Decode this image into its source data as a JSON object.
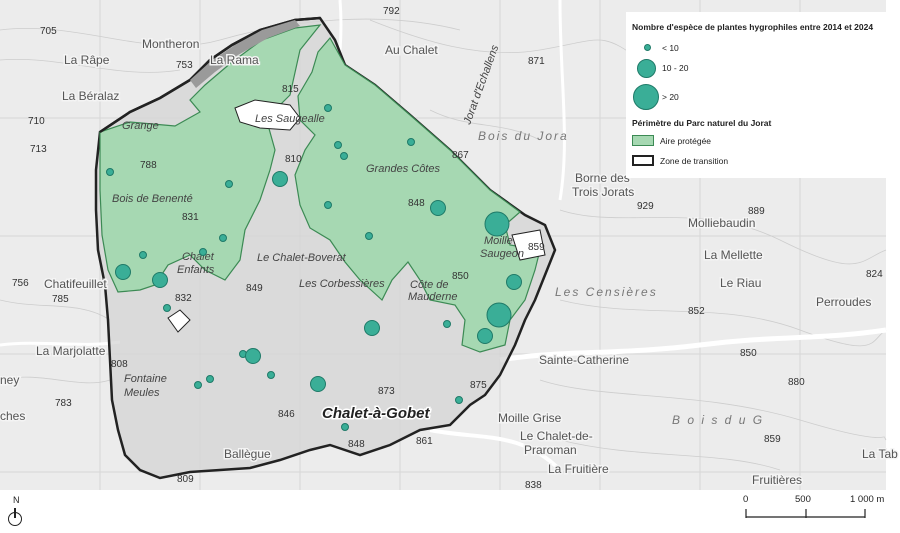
{
  "legend": {
    "species_title": "Nombre d'espèce de plantes hygrophiles entre 2014 et 2024",
    "classes": [
      {
        "label": "< 10"
      },
      {
        "label": "10 - 20"
      },
      {
        "label": "> 20"
      }
    ],
    "perimeter_title": "Périmètre du Parc naturel du Jorat",
    "protected_label": "Aire protégée",
    "transition_label": "Zone de transition"
  },
  "colors": {
    "protected_fill": "#a6d8b2",
    "protected_stroke": "#3c8a54",
    "point_fill": "#3aae97",
    "point_stroke": "#1f7a68",
    "transition_fill": "#d4d4d4",
    "transition_stroke": "#222222",
    "basemap": "#ececec"
  },
  "north": {
    "label": "N"
  },
  "scale": {
    "labels": [
      "0",
      "500",
      "1 000 m"
    ]
  },
  "map_labels": {
    "montheron": "Montheron",
    "la_rape": "La Râpe",
    "la_ramaz": "La Rama",
    "la_beralaz": "La Béralaz",
    "grange": "Grange",
    "les_saugealles": "Les Saugealle",
    "au_chalet": "Au Chalet",
    "bois_du_jorat": "Bois du Jora",
    "jorat_echallens": "Jorat d'Echallens",
    "bois_benente": "Bois de Benenté",
    "grandes_cotes": "Grandes Côtes",
    "borne": "Borne des",
    "trois_jorats": "Trois Jorats",
    "molliebaudin": "Molliebaudin",
    "la_mellette": "La Mellette",
    "moille_saugeon_1": "Moille",
    "moille_saugeon_2": "Saugeon",
    "chalet_enfants_1": "Chalet",
    "chalet_enfants_2": "Enfants",
    "le_chalet_boverat": "Le Chalet-Boverat",
    "les_corbessieres": "Les Corbessières",
    "cote_mauderne_1": "Côte de",
    "cote_mauderne_2": "Mauderne",
    "le_riau": "Le Riau",
    "les_censieres": "Les Censières",
    "perroudes": "Perroudes",
    "chatifeuillet": "Chatifeuillet",
    "la_marjolatte": "La Marjolatte",
    "sainte_catherine": "Sainte-Catherine",
    "fontaine_1": "Fontaine",
    "fontaine_2": "Meules",
    "chalet_a_gobet": "Chalet-à-Gobet",
    "moille_grise": "Moille Grise",
    "chalet_praroman_1": "Le Chalet-de-",
    "chalet_praroman_2": "Praroman",
    "la_fruitiere": "La Fruitière",
    "fruitieres": "Fruitières",
    "ballegue": "Ballègue",
    "bois_du_g": "B o i s   d u   G",
    "ney": "ney",
    "ches": "ches",
    "la_tab": "La Tab"
  },
  "altitudes": [
    "705",
    "753",
    "792",
    "815",
    "871",
    "710",
    "713",
    "810",
    "867",
    "788",
    "848",
    "831",
    "929",
    "889",
    "859",
    "756",
    "785",
    "832",
    "849",
    "850",
    "852",
    "824",
    "808",
    "850",
    "783",
    "873",
    "875",
    "880",
    "846",
    "848",
    "861",
    "859",
    "809",
    "838"
  ]
}
